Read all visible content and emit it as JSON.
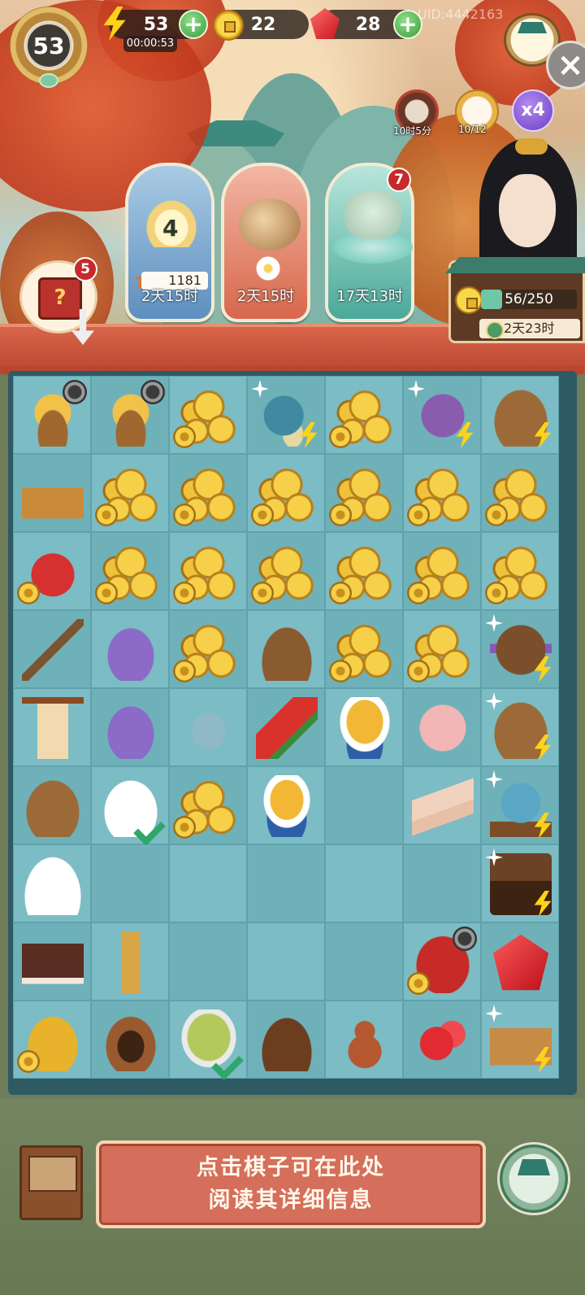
{
  "hud": {
    "level": "53",
    "energy": "53",
    "energy_timer": "00:00:53",
    "coins": "22",
    "gems": "28",
    "uid": "UID:4442163",
    "plus": "+",
    "close": "×",
    "multiplier": "x4",
    "cook_timer": "10时5分",
    "cat_count": "10/12"
  },
  "events": {
    "lotus_level": "4",
    "lotus_score": "1181",
    "card1_time": "2天15时",
    "card2_time": "2天15时",
    "card3_time": "17天13时",
    "card3_badge": "7"
  },
  "gift": {
    "badge": "5",
    "symbol": "?"
  },
  "house": {
    "progress_text": "56/250",
    "progress": 0.224,
    "timer": "2天23时"
  },
  "info": {
    "line1": "点击棋子可在此处",
    "line2": "阅读其详细信息"
  },
  "colors": {
    "board_bg": "#2d5a63",
    "cell_light": "#7cbcc4",
    "cell_dark": "#6fb1b9",
    "info_box": "#d56e5a",
    "badge_red": "#c82a2a"
  },
  "board": {
    "rows": [
      [
        {
          "i": "chicken-coop",
          "c": "it-chicken",
          "tags": [
            "clock"
          ]
        },
        {
          "i": "hen-nest",
          "c": "it-chicken",
          "tags": [
            "clock"
          ]
        },
        {
          "i": "coins",
          "c": "it-coins",
          "tags": [
            "coin"
          ]
        },
        {
          "i": "teapot-set",
          "c": "it-teapot",
          "tags": [
            "bolt",
            "spark"
          ]
        },
        {
          "i": "coins",
          "c": "it-coins",
          "tags": [
            "coin"
          ]
        },
        {
          "i": "sewing-spool",
          "c": "it-spool",
          "tags": [
            "bolt",
            "spark"
          ]
        },
        {
          "i": "food-tray",
          "c": "it-tray",
          "tags": [
            "bolt"
          ]
        }
      ],
      [
        {
          "i": "tool-basket",
          "c": "it-basket",
          "tags": []
        },
        {
          "i": "coins",
          "c": "it-coins",
          "tags": [
            "coin"
          ]
        },
        {
          "i": "coins",
          "c": "it-coins",
          "tags": [
            "coin"
          ]
        },
        {
          "i": "coins",
          "c": "it-coins",
          "tags": [
            "coin"
          ]
        },
        {
          "i": "coins",
          "c": "it-coins",
          "tags": [
            "coin"
          ]
        },
        {
          "i": "coins",
          "c": "it-coins",
          "tags": [
            "coin"
          ]
        },
        {
          "i": "coins",
          "c": "it-coins",
          "tags": [
            "coin"
          ]
        }
      ],
      [
        {
          "i": "red-jar",
          "c": "it-jar",
          "tags": [
            "coin"
          ]
        },
        {
          "i": "coins",
          "c": "it-coins",
          "tags": [
            "coin"
          ]
        },
        {
          "i": "coins",
          "c": "it-coins",
          "tags": [
            "coin"
          ]
        },
        {
          "i": "coins",
          "c": "it-coins",
          "tags": [
            "coin"
          ]
        },
        {
          "i": "coins",
          "c": "it-coins",
          "tags": [
            "coin"
          ]
        },
        {
          "i": "coins",
          "c": "it-coins",
          "tags": [
            "coin"
          ]
        },
        {
          "i": "coins",
          "c": "it-coins",
          "tags": [
            "coin"
          ]
        }
      ],
      [
        {
          "i": "brush",
          "c": "it-brush",
          "tags": []
        },
        {
          "i": "purple-sachet",
          "c": "it-sachet",
          "tags": []
        },
        {
          "i": "coins",
          "c": "it-coins",
          "tags": [
            "coin"
          ]
        },
        {
          "i": "flower-cake",
          "c": "it-cake",
          "tags": []
        },
        {
          "i": "coins",
          "c": "it-coins",
          "tags": [
            "coin"
          ]
        },
        {
          "i": "coins",
          "c": "it-coins",
          "tags": [
            "coin"
          ]
        },
        {
          "i": "sewing-box",
          "c": "it-sewing",
          "tags": [
            "bolt",
            "spark"
          ]
        }
      ],
      [
        {
          "i": "lantern",
          "c": "it-lantern",
          "tags": []
        },
        {
          "i": "small-sachet",
          "c": "it-sachet",
          "tags": []
        },
        {
          "i": "jade-pendant",
          "c": "it-jade",
          "tags": []
        },
        {
          "i": "watermelon",
          "c": "it-melon",
          "tags": []
        },
        {
          "i": "chrysanthemum-bowl",
          "c": "it-bowl",
          "tags": []
        },
        {
          "i": "pink-cake",
          "c": "it-pinkcake",
          "tags": []
        },
        {
          "i": "food-crate",
          "c": "it-tray",
          "tags": [
            "bolt",
            "spark"
          ]
        }
      ],
      [
        {
          "i": "fruit-platter",
          "c": "it-tray",
          "tags": []
        },
        {
          "i": "chicken-bowl",
          "c": "it-chicken-bowl",
          "tags": [
            "check"
          ]
        },
        {
          "i": "coins",
          "c": "it-coins",
          "tags": [
            "coin"
          ]
        },
        {
          "i": "tea-cup",
          "c": "it-cup",
          "tags": []
        },
        {
          "i": "",
          "c": "",
          "tags": []
        },
        {
          "i": "rice-rolls",
          "c": "it-rolls",
          "tags": []
        },
        {
          "i": "blue-teapot",
          "c": "it-blue-pot",
          "tags": [
            "bolt",
            "spark"
          ]
        }
      ],
      [
        {
          "i": "egg-rice",
          "c": "it-rice",
          "tags": []
        },
        {
          "i": "",
          "c": "",
          "tags": []
        },
        {
          "i": "",
          "c": "",
          "tags": []
        },
        {
          "i": "",
          "c": "",
          "tags": []
        },
        {
          "i": "",
          "c": "",
          "tags": []
        },
        {
          "i": "",
          "c": "",
          "tags": []
        },
        {
          "i": "treasure-chest",
          "c": "it-chest",
          "tags": [
            "bolt",
            "spark"
          ]
        }
      ],
      [
        {
          "i": "chocolate-block",
          "c": "it-chocolate",
          "tags": []
        },
        {
          "i": "straw-bundle",
          "c": "it-straw",
          "tags": []
        },
        {
          "i": "",
          "c": "",
          "tags": []
        },
        {
          "i": "",
          "c": "",
          "tags": []
        },
        {
          "i": "",
          "c": "",
          "tags": []
        },
        {
          "i": "red-box",
          "c": "it-redbox",
          "tags": [
            "clock",
            "coin"
          ]
        },
        {
          "i": "ruby",
          "c": "it-ruby",
          "tags": []
        }
      ],
      [
        {
          "i": "gold-pile",
          "c": "it-goldpile",
          "tags": [
            "coin"
          ]
        },
        {
          "i": "twig-nest",
          "c": "it-nest",
          "tags": []
        },
        {
          "i": "porridge-bowl",
          "c": "it-porridge",
          "tags": [
            "check"
          ]
        },
        {
          "i": "cotton-bowl",
          "c": "it-cotton",
          "tags": []
        },
        {
          "i": "energy-gourd",
          "c": "it-gourd",
          "tags": []
        },
        {
          "i": "rubies",
          "c": "it-rubies",
          "tags": []
        },
        {
          "i": "scroll-crate",
          "c": "it-scrolls",
          "tags": [
            "bolt",
            "spark"
          ]
        }
      ]
    ]
  }
}
